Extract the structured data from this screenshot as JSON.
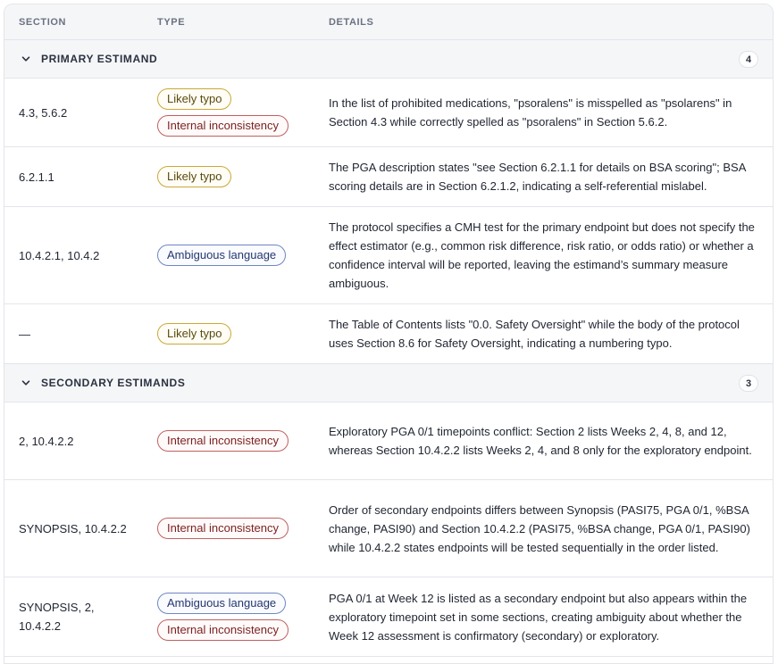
{
  "header": {
    "section": "SECTION",
    "type": "TYPE",
    "details": "DETAILS"
  },
  "groups": [
    {
      "title": "PRIMARY ESTIMAND",
      "count": "4",
      "rows": [
        {
          "section": "4.3, 5.6.2",
          "types": [
            "Likely typo",
            "Internal inconsistency"
          ],
          "details": "In the list of prohibited medications, \"psoralens\" is misspelled as \"psolarens\" in Section 4.3 while correctly spelled as \"psoralens\" in Section 5.6.2."
        },
        {
          "section": "6.2.1.1",
          "types": [
            "Likely typo"
          ],
          "details": "The PGA description states \"see Section 6.2.1.1 for details on BSA scoring\"; BSA scoring details are in Section 6.2.1.2, indicating a self-referential mislabel."
        },
        {
          "section": "10.4.2.1, 10.4.2",
          "types": [
            "Ambiguous language"
          ],
          "details": "The protocol specifies a CMH test for the primary endpoint but does not specify the effect estimator (e.g., common risk difference, risk ratio, or odds ratio) or whether a confidence interval will be reported, leaving the estimand’s summary measure ambiguous."
        },
        {
          "section": "—",
          "types": [
            "Likely typo"
          ],
          "details": "The Table of Contents lists \"0.0. Safety Oversight\" while the body of the protocol uses Section 8.6 for Safety Oversight, indicating a numbering typo."
        }
      ]
    },
    {
      "title": "SECONDARY ESTIMANDS",
      "count": "3",
      "rows": [
        {
          "section": "2, 10.4.2.2",
          "types": [
            "Internal inconsistency"
          ],
          "details": "Exploratory PGA 0/1 timepoints conflict: Section 2 lists Weeks 2, 4, 8, and 12, whereas Section 10.4.2.2 lists Weeks 2, 4, and 8 only for the exploratory endpoint."
        },
        {
          "section": "SYNOPSIS, 10.4.2.2",
          "types": [
            "Internal inconsistency"
          ],
          "details": "Order of secondary endpoints differs between Synopsis (PASI75, PGA 0/1, %BSA change, PASI90) and Section 10.4.2.2 (PASI75, %BSA change, PGA 0/1, PASI90) while 10.4.2.2 states endpoints will be tested sequentially in the order listed."
        },
        {
          "section": "SYNOPSIS, 2, 10.4.2.2",
          "types": [
            "Ambiguous language",
            "Internal inconsistency"
          ],
          "details": "PGA 0/1 at Week 12 is listed as a secondary endpoint but also appears within the exploratory timepoint set in some sections, creating ambiguity about whether the Week 12 assessment is confirmatory (secondary) or exploratory."
        }
      ]
    }
  ],
  "colors": {
    "typo_border": "#c9a83a",
    "inconsistency_border": "#c06060",
    "ambiguous_border": "#6f86c2",
    "header_bg": "#f5f6f8"
  },
  "icons": {
    "group_toggle": "chevron-down-icon"
  }
}
